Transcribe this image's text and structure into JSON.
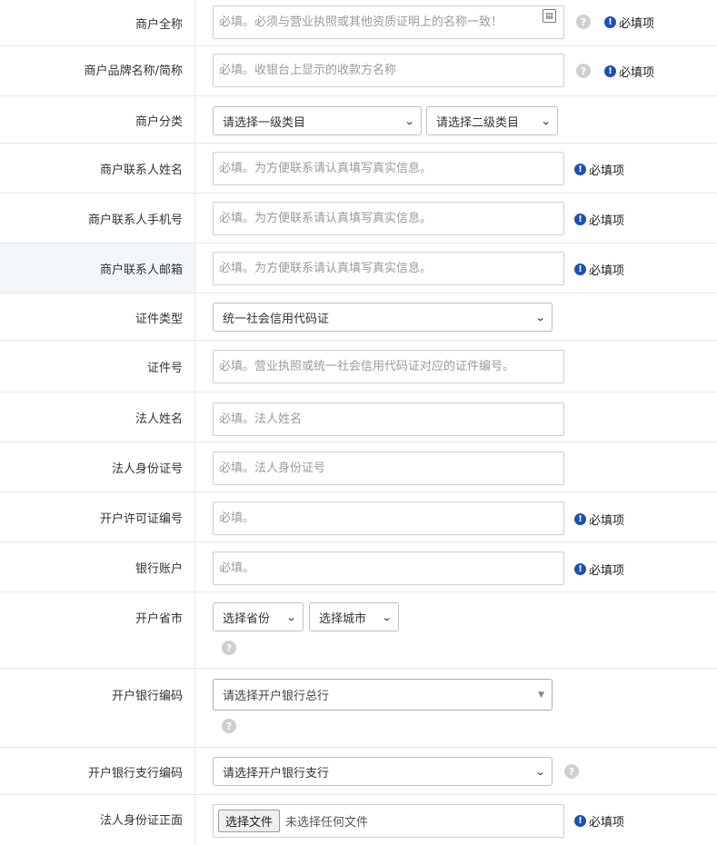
{
  "rows": [
    {
      "label": "商户全称",
      "placeholder": "必填。必须与营业执照或其他资质证明上的名称一致！",
      "help": "?",
      "required": "必填项"
    },
    {
      "label": "商户品牌名称/简称",
      "placeholder": "必填。收银台上显示的收款方名称",
      "help": "?",
      "required": "必填项"
    },
    {
      "label": "商户分类",
      "select1": "请选择一级类目",
      "select2": "请选择二级类目"
    },
    {
      "label": "商户联系人姓名",
      "placeholder": "必填。为方便联系请认真填写真实信息。",
      "required": "必填项"
    },
    {
      "label": "商户联系人手机号",
      "placeholder": "必填。为方便联系请认真填写真实信息。",
      "required": "必填项"
    },
    {
      "label": "商户联系人邮箱",
      "placeholder": "必填。为方便联系请认真填写真实信息。",
      "required": "必填项"
    },
    {
      "label": "证件类型",
      "select": "统一社会信用代码证"
    },
    {
      "label": "证件号",
      "placeholder": "必填。营业执照或统一社会信用代码证对应的证件编号。"
    },
    {
      "label": "法人姓名",
      "placeholder": "必填。法人姓名"
    },
    {
      "label": "法人身份证号",
      "placeholder": "必填。法人身份证号"
    },
    {
      "label": "开户许可证编号",
      "placeholder": "必填。",
      "required": "必填项"
    },
    {
      "label": "银行账户",
      "placeholder": "必填。",
      "required": "必填项"
    },
    {
      "label": "开户省市",
      "select1": "选择省份",
      "select2": "选择城市",
      "help": "?"
    },
    {
      "label": "开户银行编码",
      "select": "请选择开户银行总行",
      "help": "?"
    },
    {
      "label": "开户银行支行编码",
      "select": "请选择开户银行支行",
      "help": "?"
    },
    {
      "label": "法人身份证正面",
      "file_button": "选择文件",
      "file_status": "未选择任何文件",
      "required": "必填项"
    }
  ]
}
